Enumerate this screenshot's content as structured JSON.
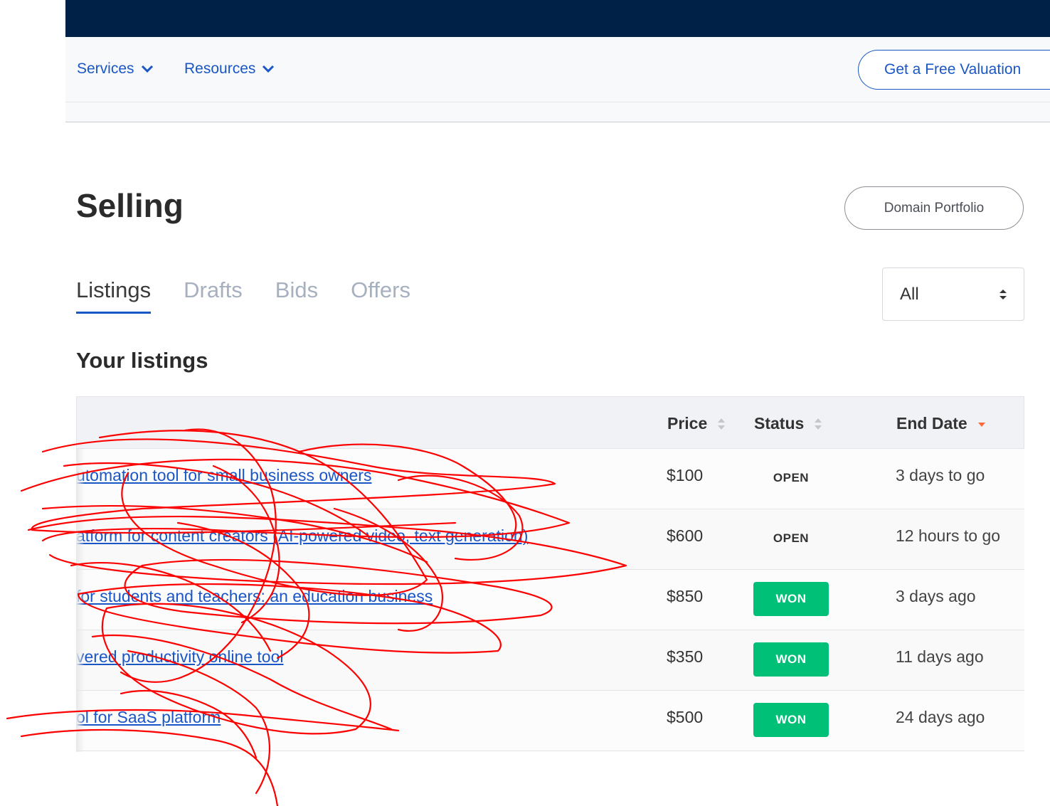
{
  "nav": {
    "services": "Services",
    "resources": "Resources",
    "valuation": "Get a Free Valuation"
  },
  "page": {
    "title": "Selling",
    "portfolio_button": "Domain Portfolio",
    "section_title": "Your listings"
  },
  "tabs": [
    {
      "label": "Listings",
      "active": true
    },
    {
      "label": "Drafts",
      "active": false
    },
    {
      "label": "Bids",
      "active": false
    },
    {
      "label": "Offers",
      "active": false
    }
  ],
  "filter": {
    "selected": "All"
  },
  "table": {
    "headers": {
      "price": "Price",
      "status": "Status",
      "end_date": "End Date"
    },
    "rows": [
      {
        "name": "utomation tool for small business owners",
        "price": "$100",
        "status": "OPEN",
        "end": "3 days to go"
      },
      {
        "name": "atform for content creators (AI-powered video, text generation)",
        "price": "$600",
        "status": "OPEN",
        "end": "12 hours to go"
      },
      {
        "name": " for students and teachers: an education business",
        "price": "$850",
        "status": "WON",
        "end": "3 days ago"
      },
      {
        "name": "vered productivity online tool",
        "price": "$350",
        "status": "WON",
        "end": "11 days ago"
      },
      {
        "name": "ol for SaaS platform",
        "price": "$500",
        "status": "WON",
        "end": "24 days ago"
      }
    ]
  },
  "colors": {
    "topbar": "#002147",
    "link": "#1a56c6",
    "won": "#00c078",
    "sort_active": "#ff6a3d",
    "scribble": "#ff0000"
  }
}
